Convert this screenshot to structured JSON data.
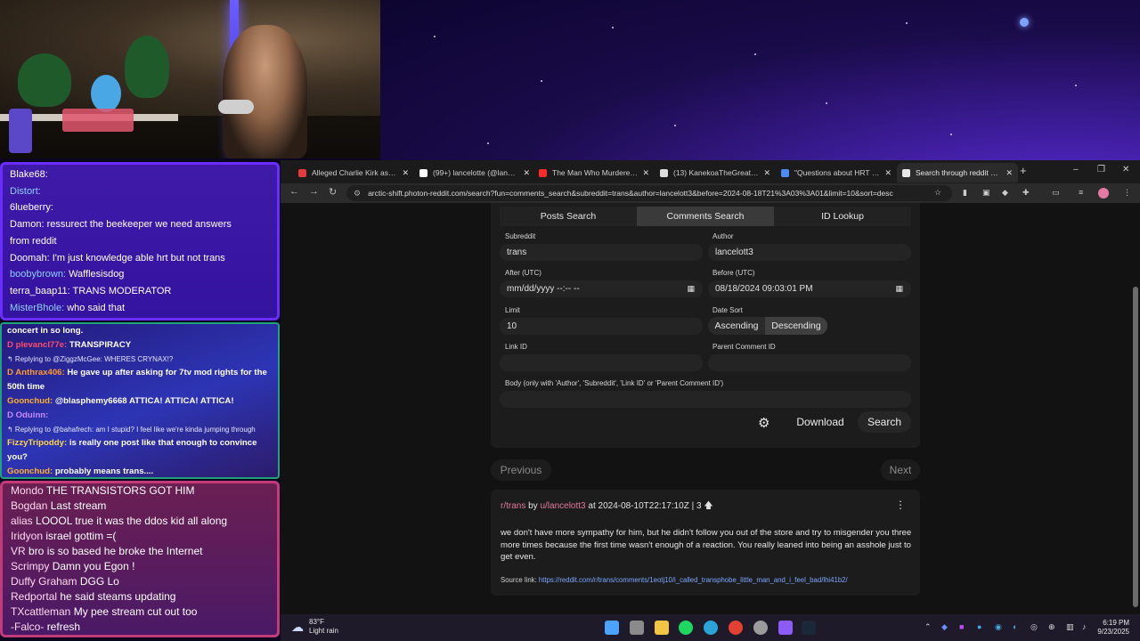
{
  "chat1": [
    {
      "user": "Blake68:",
      "msg": " ",
      "color": "#ffffff"
    },
    {
      "user": "Distort:",
      "msg": " ",
      "color": "#8fd0ff"
    },
    {
      "user": "6lueberry:",
      "msg": " ",
      "color": "#ffffff"
    },
    {
      "user": "Damon:",
      "msg": "ressurect the beekeeper   we need answers",
      "color": "#ffffff"
    },
    {
      "user": "",
      "msg": "from reddit",
      "color": "#ffffff"
    },
    {
      "user": "Doomah:",
      "msg": "I'm just knowledge able hrt but not trans",
      "color": "#ffffff"
    },
    {
      "user": "boobybrown:",
      "msg": "Wafflesisdog",
      "color": "#8fd0ff"
    },
    {
      "user": "terra_baap11:",
      "msg": "TRANS MODERATOR",
      "color": "#ffffff"
    },
    {
      "user": "MisterBhole:",
      "msg": "who said that",
      "color": "#8fd0ff"
    }
  ],
  "chat2": [
    {
      "user": "",
      "msg": "concert in so long.",
      "color": "#ffffff",
      "kind": "msg"
    },
    {
      "user": "D plevancl77e:",
      "msg": "TRANSPIRACY",
      "color": "#ff4d6d",
      "kind": "msg"
    },
    {
      "user": "",
      "msg": "↰ Replying to @ZiggzMcGee: WHERES CRYNAX!?",
      "color": "#ffffff",
      "kind": "reply"
    },
    {
      "user": "D Anthrax406:",
      "msg": "He gave up after asking for 7tv mod rights for the",
      "color": "#ff9a2e",
      "kind": "msg"
    },
    {
      "user": "",
      "msg": "50th time",
      "color": "#ffffff",
      "kind": "msg"
    },
    {
      "user": "Goonchud:",
      "msg": "@blasphemy6668 ATTICA! ATTICA! ATTICA!",
      "color": "#ffb02e",
      "kind": "msg"
    },
    {
      "user": "D Oduinn:",
      "msg": "",
      "color": "#c78bff",
      "kind": "msg"
    },
    {
      "user": "",
      "msg": "↰ Replying to @bahafrech: am I stupid? I feel like we're kinda jumping through",
      "color": "#ffffff",
      "kind": "reply"
    },
    {
      "user": "FizzyTripoddy:",
      "msg": "is really one post like that enough to convince",
      "color": "#ffd54a",
      "kind": "msg"
    },
    {
      "user": "",
      "msg": "you?",
      "color": "#ffffff",
      "kind": "msg"
    },
    {
      "user": "Goonchud:",
      "msg": "probably means trans....",
      "color": "#ffb02e",
      "kind": "msg"
    }
  ],
  "chat3": [
    {
      "user": "Mondo",
      "msg": "THE TRANSISTORS GOT HIM"
    },
    {
      "user": "Bogdan",
      "msg": "Last stream"
    },
    {
      "user": "alias",
      "msg": "LOOOL true it was the ddos kid all along"
    },
    {
      "user": "Iridyon",
      "msg": "israel gottim =("
    },
    {
      "user": "VR",
      "msg": "bro is so based he broke the Internet"
    },
    {
      "user": "Scrimpy",
      "msg": "Damn you Egon !"
    },
    {
      "user": "Duffy Graham",
      "msg": "DGG Lo"
    },
    {
      "user": "Redportal",
      "msg": "he said steams updating"
    },
    {
      "user": "TXcattleman",
      "msg": "My pee stream cut out too"
    },
    {
      "user": "-Falco-",
      "msg": "refresh"
    }
  ],
  "browser": {
    "tabs": [
      {
        "title": "Alleged Charlie Kirk assassin",
        "color": "#e23b3b",
        "active": false
      },
      {
        "title": "(99+) lancelotte (@lancelott)",
        "color": "#ffffff",
        "active": false
      },
      {
        "title": "The Man Who Murdered C",
        "color": "#ff2a2a",
        "active": false
      },
      {
        "title": "(13) KanekoaTheGreat on X",
        "color": "#dddddd",
        "active": false
      },
      {
        "title": "\"Questions about HRT for g",
        "color": "#4c8bf5",
        "active": false
      },
      {
        "title": "Search through reddit data",
        "color": "#e8e8e8",
        "active": true
      }
    ],
    "url": "arctic-shift.photon-reddit.com/search?fun=comments_search&subreddit=trans&author=lancelott3&before=2024-08-18T21%3A03%3A01&limit=10&sort=desc"
  },
  "form": {
    "tabs": [
      "Posts Search",
      "Comments Search",
      "ID Lookup"
    ],
    "subreddit_label": "Subreddit",
    "subreddit_value": "trans",
    "author_label": "Author",
    "author_value": "lancelott3",
    "after_label": "After (UTC)",
    "after_value": "mm/dd/yyyy --:-- --",
    "before_label": "Before (UTC)",
    "before_value": "08/18/2024 09:03:01 PM",
    "limit_label": "Limit",
    "limit_value": "10",
    "datesort_label": "Date Sort",
    "ascending": "Ascending",
    "descending": "Descending",
    "linkid_label": "Link ID",
    "parent_label": "Parent Comment ID",
    "body_label": "Body (only with 'Author', 'Subreddit', 'Link ID' or 'Parent Comment ID')",
    "download": "Download",
    "search": "Search",
    "previous": "Previous",
    "next": "Next"
  },
  "result": {
    "subreddit": "r/trans",
    "by": "by",
    "user": "u/lancelott3",
    "meta": "at 2024-08-10T22:17:10Z | 3",
    "body": "we don't have more sympathy for him, but he didn't follow you out of the store and try to misgender you three more times because the first time wasn't enough of a reaction. You really leaned into being an asshole just to get even.",
    "source_label": "Source link:",
    "source_url": "https://reddit.com/r/trans/comments/1eotj10/i_called_transphobe_little_man_and_i_feel_bad/lhi41b2/"
  },
  "taskbar": {
    "temp": "83°F",
    "weather": "Light rain",
    "time": "6:19 PM",
    "date": "9/23/2025"
  }
}
